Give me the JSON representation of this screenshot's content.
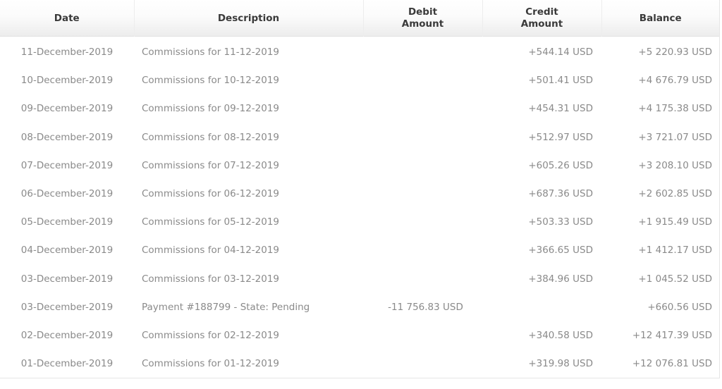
{
  "table": {
    "headers": {
      "date": "Date",
      "description": "Description",
      "debit_line1": "Debit",
      "debit_line2": "Amount",
      "credit_line1": "Credit",
      "credit_line2": "Amount",
      "balance": "Balance"
    },
    "rows": [
      {
        "date": "11-December-2019",
        "description": "Commissions for 11-12-2019",
        "debit": "",
        "credit": "+544.14 USD",
        "balance": "+5 220.93 USD"
      },
      {
        "date": "10-December-2019",
        "description": "Commissions for 10-12-2019",
        "debit": "",
        "credit": "+501.41 USD",
        "balance": "+4 676.79 USD"
      },
      {
        "date": "09-December-2019",
        "description": "Commissions for 09-12-2019",
        "debit": "",
        "credit": "+454.31 USD",
        "balance": "+4 175.38 USD"
      },
      {
        "date": "08-December-2019",
        "description": "Commissions for 08-12-2019",
        "debit": "",
        "credit": "+512.97 USD",
        "balance": "+3 721.07 USD"
      },
      {
        "date": "07-December-2019",
        "description": "Commissions for 07-12-2019",
        "debit": "",
        "credit": "+605.26 USD",
        "balance": "+3 208.10 USD"
      },
      {
        "date": "06-December-2019",
        "description": "Commissions for 06-12-2019",
        "debit": "",
        "credit": "+687.36 USD",
        "balance": "+2 602.85 USD"
      },
      {
        "date": "05-December-2019",
        "description": "Commissions for 05-12-2019",
        "debit": "",
        "credit": "+503.33 USD",
        "balance": "+1 915.49 USD"
      },
      {
        "date": "04-December-2019",
        "description": "Commissions for 04-12-2019",
        "debit": "",
        "credit": "+366.65 USD",
        "balance": "+1 412.17 USD"
      },
      {
        "date": "03-December-2019",
        "description": "Commissions for 03-12-2019",
        "debit": "",
        "credit": "+384.96 USD",
        "balance": "+1 045.52 USD"
      },
      {
        "date": "03-December-2019",
        "description": "Payment #188799 - State: Pending",
        "debit": "-11 756.83 USD",
        "credit": "",
        "balance": "+660.56 USD"
      },
      {
        "date": "02-December-2019",
        "description": "Commissions for 02-12-2019",
        "debit": "",
        "credit": "+340.58 USD",
        "balance": "+12 417.39 USD"
      },
      {
        "date": "01-December-2019",
        "description": "Commissions for 01-12-2019",
        "debit": "",
        "credit": "+319.98 USD",
        "balance": "+12 076.81 USD"
      }
    ]
  }
}
